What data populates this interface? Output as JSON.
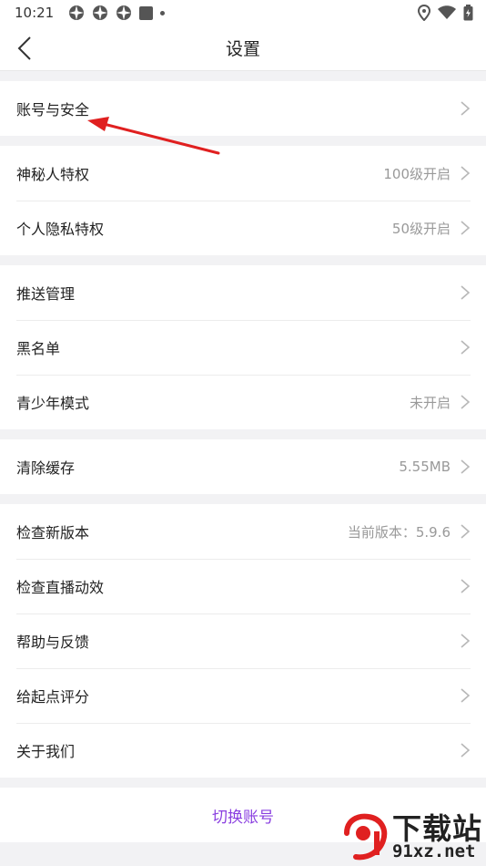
{
  "status_bar": {
    "time": "10:21"
  },
  "nav": {
    "title": "设置"
  },
  "sections": [
    {
      "items": [
        {
          "label": "账号与安全",
          "value": ""
        }
      ]
    },
    {
      "items": [
        {
          "label": "神秘人特权",
          "value": "100级开启"
        },
        {
          "label": "个人隐私特权",
          "value": "50级开启"
        }
      ]
    },
    {
      "items": [
        {
          "label": "推送管理",
          "value": ""
        },
        {
          "label": "黑名单",
          "value": ""
        },
        {
          "label": "青少年模式",
          "value": "未开启"
        }
      ]
    },
    {
      "items": [
        {
          "label": "清除缓存",
          "value": "5.55MB"
        }
      ]
    },
    {
      "items": [
        {
          "label": "检查新版本",
          "value": "当前版本：5.9.6"
        },
        {
          "label": "检查直播动效",
          "value": ""
        },
        {
          "label": "帮助与反馈",
          "value": ""
        },
        {
          "label": "给起点评分",
          "value": ""
        },
        {
          "label": "关于我们",
          "value": ""
        }
      ]
    }
  ],
  "switch_account": {
    "label": "切换账号"
  },
  "watermark": {
    "title": "下载站",
    "url": "91xz.net"
  },
  "colors": {
    "accent": "#8a3fe0",
    "annotation": "#e02020"
  }
}
